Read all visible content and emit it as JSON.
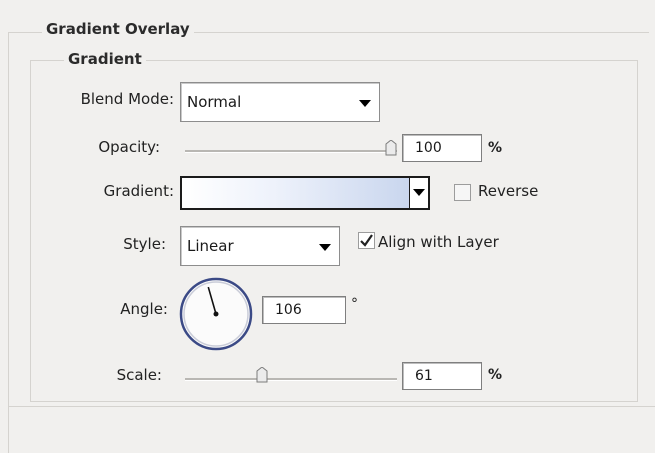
{
  "panel": {
    "title": "Gradient Overlay",
    "section": "Gradient"
  },
  "blend_mode": {
    "label": "Blend Mode:",
    "value": "Normal"
  },
  "opacity": {
    "label": "Opacity:",
    "value": "100",
    "unit": "%",
    "slider_fraction": 1.0
  },
  "gradient": {
    "label": "Gradient:",
    "reverse_label": "Reverse",
    "reverse_checked": false,
    "colors": [
      "#ffffff",
      "#c9d6ee"
    ]
  },
  "style": {
    "label": "Style:",
    "value": "Linear",
    "align_label": "Align with Layer",
    "align_checked": true
  },
  "angle": {
    "label": "Angle:",
    "value": "106",
    "unit": "°",
    "degrees": 106
  },
  "scale": {
    "label": "Scale:",
    "value": "61",
    "unit": "%",
    "slider_fraction": 0.355
  },
  "colors": {
    "background": "#f1f0ee",
    "frame": "#d5d3cf",
    "dial_ring": "#3b4a86"
  }
}
